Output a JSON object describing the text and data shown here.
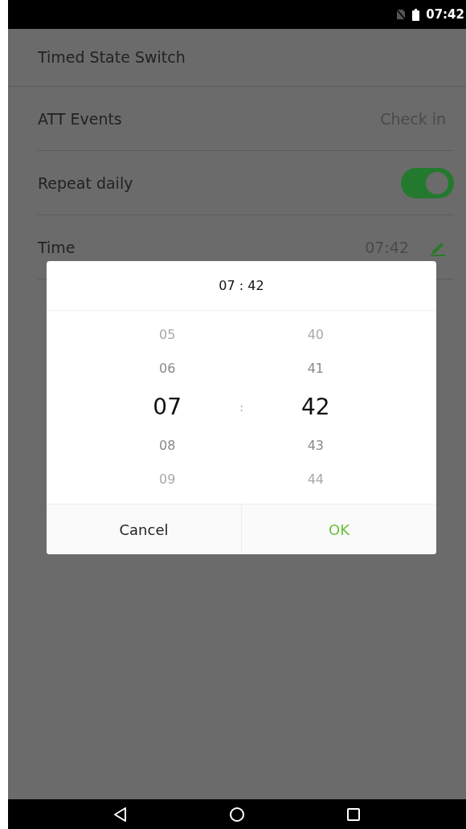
{
  "status_bar": {
    "time": "07:42"
  },
  "screen": {
    "title": "Timed State Switch"
  },
  "settings": [
    {
      "kind": "value",
      "label": "ATT Events",
      "value": "Check in"
    },
    {
      "kind": "toggle",
      "label": "Repeat daily",
      "on": true
    },
    {
      "kind": "edit",
      "label": "Time",
      "value": "07:42"
    }
  ],
  "dialog": {
    "title": "07 : 42",
    "separator": ":",
    "hours": [
      {
        "label": "05",
        "selected": false
      },
      {
        "label": "06",
        "selected": false
      },
      {
        "label": "07",
        "selected": true
      },
      {
        "label": "08",
        "selected": false
      },
      {
        "label": "09",
        "selected": false
      }
    ],
    "minutes": [
      {
        "label": "40",
        "selected": false
      },
      {
        "label": "41",
        "selected": false
      },
      {
        "label": "42",
        "selected": true
      },
      {
        "label": "43",
        "selected": false
      },
      {
        "label": "44",
        "selected": false
      }
    ],
    "buttons": [
      {
        "label": "Cancel",
        "kind": "cancel"
      },
      {
        "label": "OK",
        "kind": "confirm"
      }
    ]
  }
}
